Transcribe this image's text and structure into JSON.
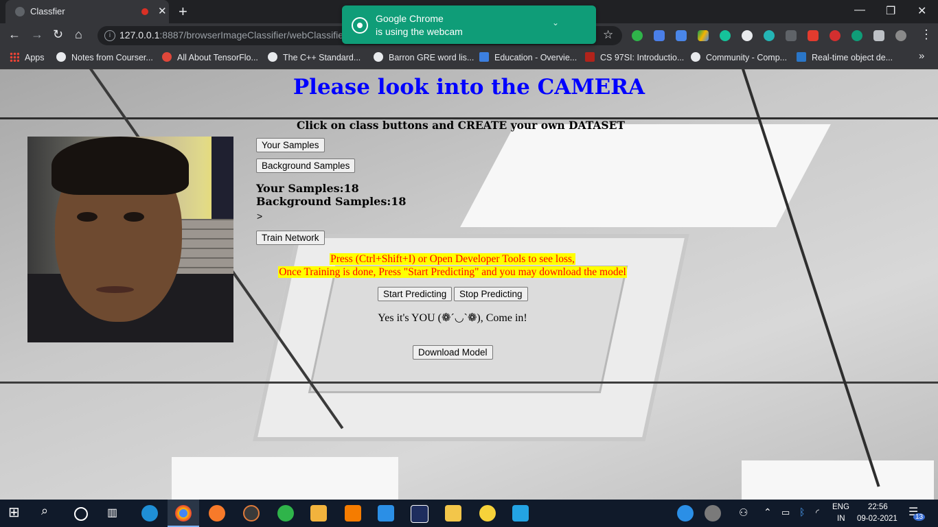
{
  "browser": {
    "tab_title": "Classfier",
    "url_host": "127.0.0.1",
    "url_rest": ":8887/browserImageClassifier/webClassifier.",
    "bookmarks": [
      {
        "label": "Apps",
        "color": "#ea4335"
      },
      {
        "label": "Notes from Courser...",
        "color": "#ffffff"
      },
      {
        "label": "All About TensorFlo...",
        "color": "#e0473a"
      },
      {
        "label": "The C++ Standard...",
        "color": "#ffffff"
      },
      {
        "label": "Barron GRE word lis...",
        "color": "#ffffff"
      },
      {
        "label": "Education - Overvie...",
        "color": "#3c7fe0"
      },
      {
        "label": "CS 97SI: Introductio...",
        "color": "#b1231b"
      },
      {
        "label": "Community - Comp...",
        "color": "#ffffff"
      },
      {
        "label": "Real-time object de...",
        "color": "#2a76c8"
      }
    ],
    "bookmarks_overflow": "»"
  },
  "notification": {
    "title": "Google Chrome",
    "subtitle": "is using the webcam"
  },
  "page": {
    "heading": "Please look into the CAMERA",
    "subheading": "Click on class buttons and CREATE your own DATASET",
    "your_samples_button": "Your Samples",
    "background_samples_button": "Background Samples",
    "your_samples_count": "Your Samples:18",
    "background_samples_count": "Background Samples:18",
    "arrow": ">",
    "train_button": "Train Network",
    "notice_line1": "Press (Ctrl+Shift+I) or Open Developer Tools to see loss,",
    "notice_line2": "Once Training is done, Press \"Start Predicting\" and you may download the model",
    "start_button": "Start Predicting",
    "stop_button": "Stop Predicting",
    "prediction": "Yes it's YOU (❁´◡`❁), Come in!",
    "download_button": "Download Model"
  },
  "taskbar": {
    "lang_top": "ENG",
    "lang_bottom": "IN",
    "time": "22:56",
    "date": "09-02-2021",
    "notification_count": "13"
  }
}
